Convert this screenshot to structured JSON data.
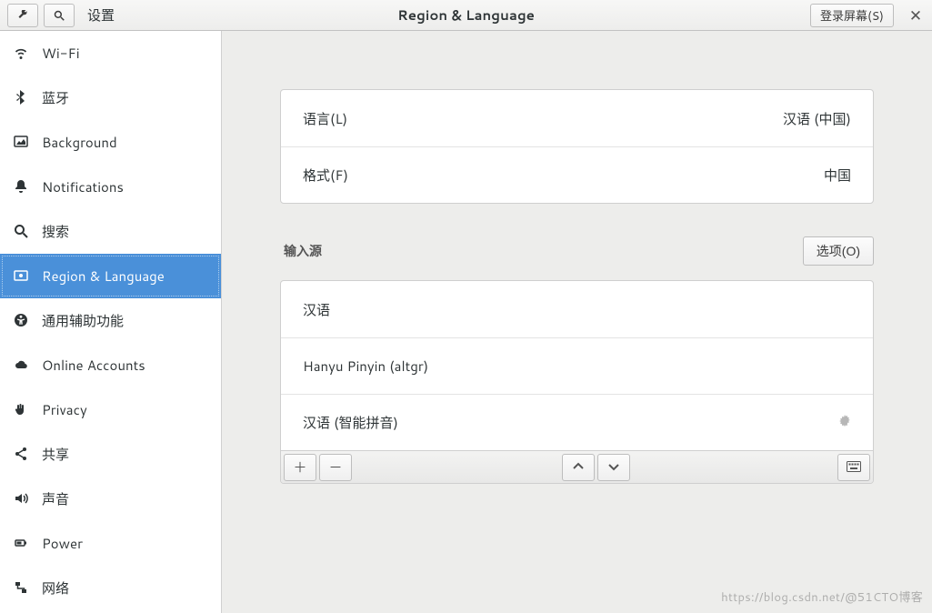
{
  "header": {
    "settings_label": "设置",
    "page_title": "Region & Language",
    "login_screen_btn": "登录屏幕(S)"
  },
  "sidebar": {
    "items": [
      {
        "icon": "wifi",
        "label": "Wi-Fi"
      },
      {
        "icon": "bluetooth",
        "label": "蓝牙"
      },
      {
        "icon": "background",
        "label": "Background"
      },
      {
        "icon": "bell",
        "label": "Notifications"
      },
      {
        "icon": "search",
        "label": "搜索"
      },
      {
        "icon": "region",
        "label": "Region & Language",
        "selected": true
      },
      {
        "icon": "a11y",
        "label": "通用辅助功能"
      },
      {
        "icon": "cloud",
        "label": "Online Accounts"
      },
      {
        "icon": "hand",
        "label": "Privacy"
      },
      {
        "icon": "share",
        "label": "共享"
      },
      {
        "icon": "volume",
        "label": "声音"
      },
      {
        "icon": "power",
        "label": "Power"
      },
      {
        "icon": "network",
        "label": "网络"
      }
    ]
  },
  "main": {
    "language_row": {
      "label": "语言(L)",
      "value": "汉语 (中国)"
    },
    "formats_row": {
      "label": "格式(F)",
      "value": "中国"
    },
    "input_sources": {
      "section_label": "输入源",
      "options_btn": "选项(O)",
      "items": [
        {
          "label": "汉语"
        },
        {
          "label": "Hanyu Pinyin (altgr)"
        },
        {
          "label": "汉语 (智能拼音)",
          "has_settings": true
        }
      ]
    }
  },
  "watermark": "https://blog.csdn.net/@51CTO博客"
}
